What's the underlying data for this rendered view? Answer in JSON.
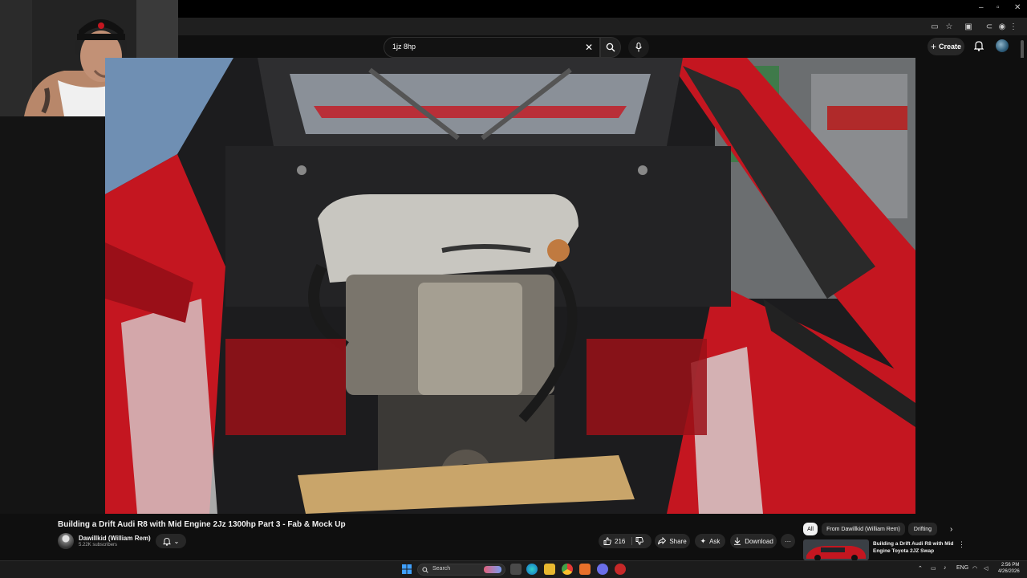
{
  "window_controls": {
    "minimize": "–",
    "maximize": "▫",
    "close": "✕"
  },
  "search": {
    "query": "1jz 8hp",
    "clear": "✕"
  },
  "header": {
    "create_label": "Create"
  },
  "video": {
    "title": "Building a Drift Audi R8 with Mid Engine 2Jz 1300hp Part 3 - Fab & Mock Up",
    "channel_name": "Dawillkid (William Rem)",
    "subscribers": "5.22K subscribers",
    "likes": "216",
    "share_label": "Share",
    "ask_label": "Ask",
    "download_label": "Download",
    "more_label": "···"
  },
  "sidebar": {
    "chips": [
      "All",
      "From Dawillkid (William Rem)",
      "Drifting"
    ],
    "next": "›",
    "recommendation": {
      "title": "Building a Drift Audi R8 with Mid Engine Toyota 2JZ Swap",
      "more": "⋮"
    }
  },
  "taskbar": {
    "search_label": "Search",
    "language": "ENG",
    "time": "2:56 PM",
    "date": "4/26/2026"
  },
  "icons": [
    "search-icon",
    "mic-icon",
    "bell-icon",
    "like-icon",
    "dislike-icon",
    "share-icon",
    "ask-icon",
    "download-icon",
    "windows-icon"
  ],
  "colors": {
    "background": "#0f0f0f",
    "pill": "#272727",
    "text": "#f1f1f1",
    "car_red": "#c41620"
  }
}
